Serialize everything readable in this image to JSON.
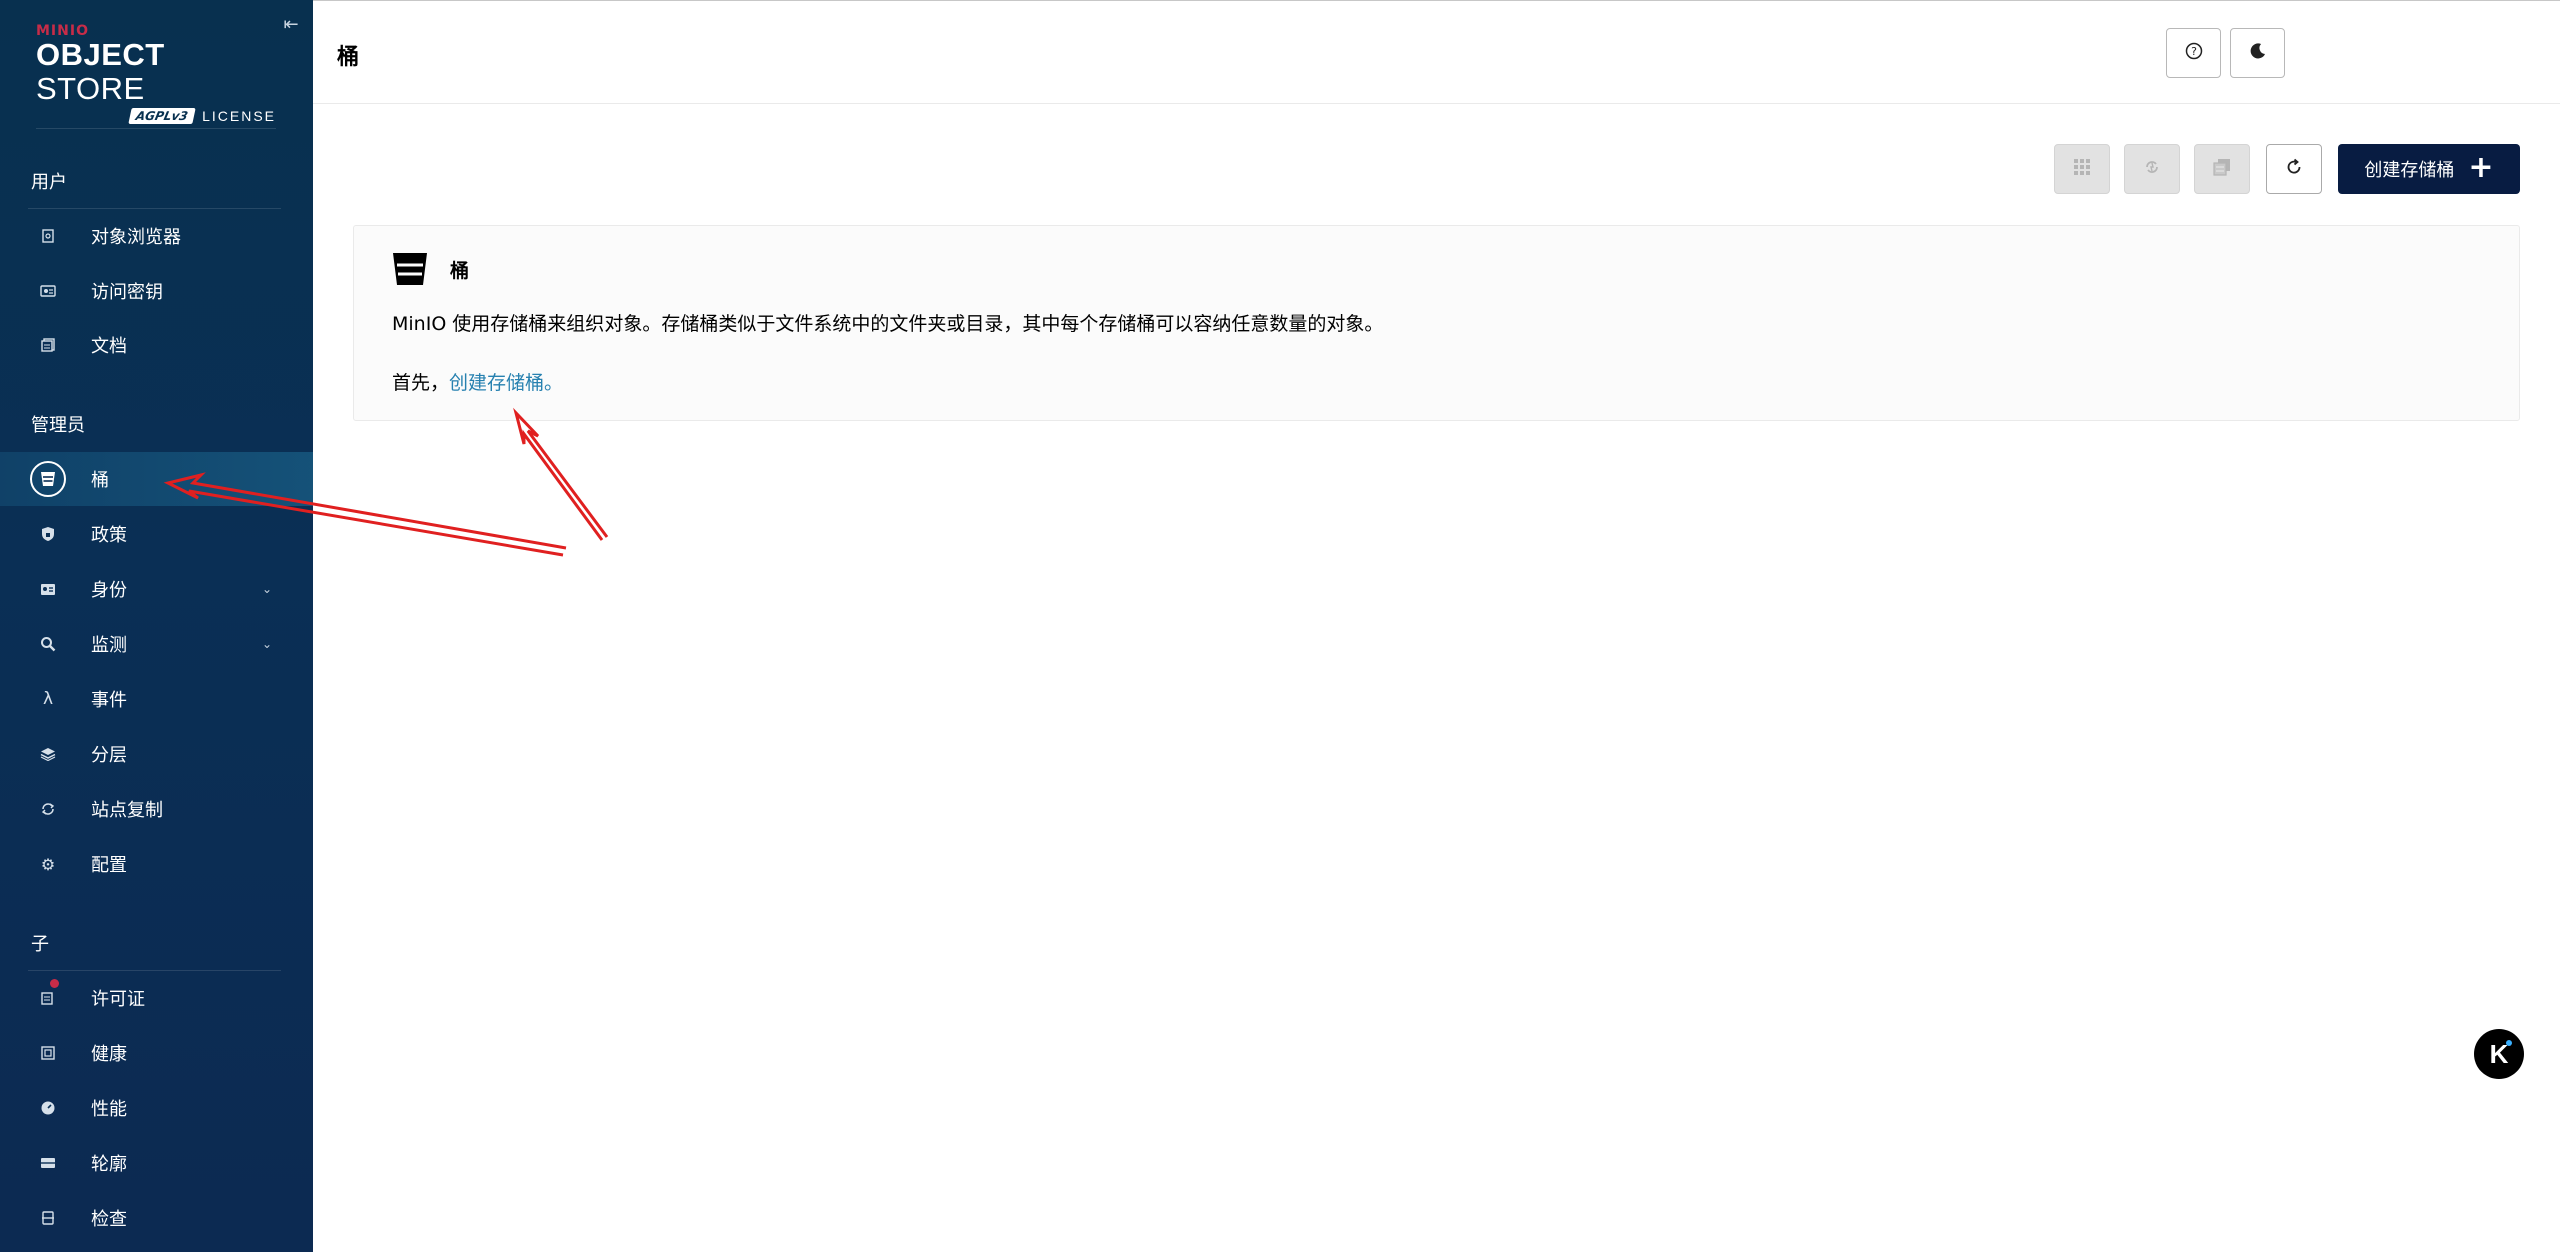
{
  "logo": {
    "brand": "MINIO",
    "title_bold": "OBJECT",
    "title_light": " STORE",
    "badge": "AGPLv3",
    "license": "LICENSE"
  },
  "sidebar": {
    "sections": [
      {
        "title": "用户"
      },
      {
        "title": "管理员"
      },
      {
        "title": "子"
      }
    ],
    "user_items": [
      {
        "label": "对象浏览器",
        "icon": "object-browser-icon"
      },
      {
        "label": "访问密钥",
        "icon": "access-keys-icon"
      },
      {
        "label": "文档",
        "icon": "documentation-icon"
      }
    ],
    "admin_items": [
      {
        "label": "桶",
        "icon": "bucket-icon",
        "active": true
      },
      {
        "label": "政策",
        "icon": "policy-shield-icon"
      },
      {
        "label": "身份",
        "icon": "identity-card-icon",
        "expandable": true
      },
      {
        "label": "监测",
        "icon": "monitoring-search-icon",
        "expandable": true
      },
      {
        "label": "事件",
        "icon": "lambda-events-icon"
      },
      {
        "label": "分层",
        "icon": "tiers-layers-icon"
      },
      {
        "label": "站点复制",
        "icon": "site-replication-icon"
      },
      {
        "label": "配置",
        "icon": "settings-gear-icon"
      }
    ],
    "sub_items": [
      {
        "label": "许可证",
        "icon": "license-icon",
        "badge_color": "#c72c48"
      },
      {
        "label": "健康",
        "icon": "health-icon"
      },
      {
        "label": "性能",
        "icon": "performance-gauge-icon"
      },
      {
        "label": "轮廓",
        "icon": "profile-icon"
      },
      {
        "label": "检查",
        "icon": "inspect-icon"
      }
    ]
  },
  "header": {
    "title": "桶",
    "help_icon": "help-circle-icon",
    "theme_icon": "dark-mode-moon-icon"
  },
  "toolbar": {
    "create_label": "创建存储桶",
    "buttons": [
      "select-multiple-icon",
      "replication-icon",
      "lifecycle-icon",
      "refresh-icon"
    ]
  },
  "panel": {
    "title": "桶",
    "description": "MinIO 使用存储桶来组织对象。存储桶类似于文件系统中的文件夹或目录，其中每个存储桶可以容纳任意数量的对象。",
    "start_prefix": "首先，",
    "start_link": "创建存储桶。"
  },
  "floating": {
    "label": "K"
  },
  "colors": {
    "sidebar_bg": "#0a2f55",
    "brand_red": "#c72c48",
    "primary_button": "#081c42",
    "link": "#2781b0",
    "annotation_arrow": "#e02020"
  }
}
